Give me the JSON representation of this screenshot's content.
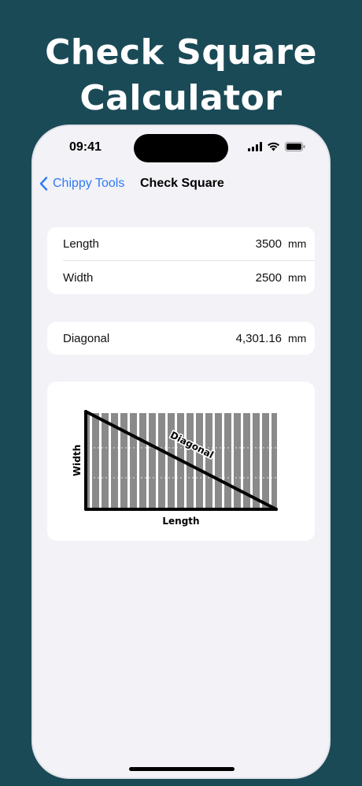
{
  "headline": {
    "line1": "Check Square",
    "line2": "Calculator"
  },
  "status_bar": {
    "time": "09:41"
  },
  "nav": {
    "back_label": "Chippy Tools",
    "title": "Check Square"
  },
  "inputs": {
    "length": {
      "label": "Length",
      "value": "3500",
      "unit": "mm"
    },
    "width": {
      "label": "Width",
      "value": "2500",
      "unit": "mm"
    }
  },
  "result": {
    "label": "Diagonal",
    "value": "4,301.16",
    "unit": "mm"
  },
  "diagram": {
    "width_label": "Width",
    "length_label": "Length",
    "diagonal_label": "Diagonal"
  }
}
